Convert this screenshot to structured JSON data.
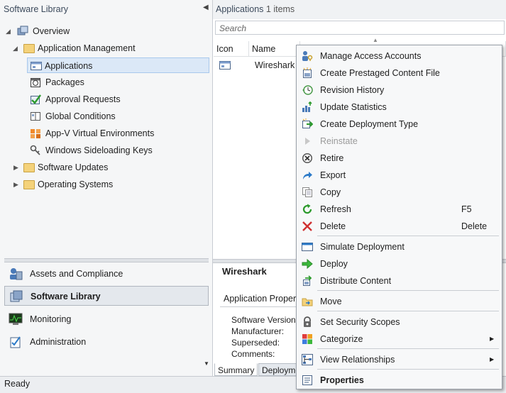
{
  "left_pane": {
    "title": "Software Library",
    "tree": {
      "overview": "Overview",
      "app_mgmt": "Application Management",
      "applications": "Applications",
      "packages": "Packages",
      "approval": "Approval Requests",
      "global_conditions": "Global Conditions",
      "appv": "App-V Virtual Environments",
      "sideloading": "Windows Sideloading Keys",
      "software_updates": "Software Updates",
      "os": "Operating Systems"
    },
    "workspaces": {
      "assets": "Assets and Compliance",
      "library": "Software Library",
      "monitoring": "Monitoring",
      "admin": "Administration"
    }
  },
  "right_pane": {
    "title_main": "Applications",
    "title_count": "1 items",
    "search_placeholder": "Search",
    "columns": {
      "icon": "Icon",
      "name": "Name"
    },
    "row_name": "Wireshark",
    "details": {
      "title": "Wireshark",
      "group": "Application Propert",
      "labels": [
        "Software Version:",
        "Manufacturer:",
        "Superseded:",
        "Comments:"
      ],
      "tabs": [
        "Summary",
        "Deployme"
      ]
    }
  },
  "status": "Ready",
  "context_menu": {
    "items": [
      {
        "label": "Manage Access Accounts",
        "icon": "manage-access-icon"
      },
      {
        "label": "Create Prestaged Content File",
        "icon": "prestaged-content-icon"
      },
      {
        "label": "Revision History",
        "icon": "revision-history-icon"
      },
      {
        "label": "Update Statistics",
        "icon": "update-statistics-icon"
      },
      {
        "label": "Create Deployment Type",
        "icon": "create-deployment-type-icon"
      },
      {
        "label": "Reinstate",
        "icon": "reinstate-icon",
        "disabled": true
      },
      {
        "label": "Retire",
        "icon": "retire-icon"
      },
      {
        "label": "Export",
        "icon": "export-icon"
      },
      {
        "label": "Copy",
        "icon": "copy-icon"
      },
      {
        "label": "Refresh",
        "icon": "refresh-icon",
        "shortcut": "F5"
      },
      {
        "label": "Delete",
        "icon": "delete-icon",
        "shortcut": "Delete"
      },
      {
        "label": "Simulate Deployment",
        "icon": "simulate-deployment-icon"
      },
      {
        "label": "Deploy",
        "icon": "deploy-icon"
      },
      {
        "label": "Distribute Content",
        "icon": "distribute-content-icon"
      },
      {
        "label": "Move",
        "icon": "move-icon"
      },
      {
        "label": "Set Security Scopes",
        "icon": "security-scopes-icon"
      },
      {
        "label": "Categorize",
        "icon": "categorize-icon",
        "submenu": true
      },
      {
        "label": "View Relationships",
        "icon": "view-relationships-icon",
        "submenu": true
      },
      {
        "label": "Properties",
        "icon": "properties-icon",
        "bold": true
      }
    ]
  }
}
